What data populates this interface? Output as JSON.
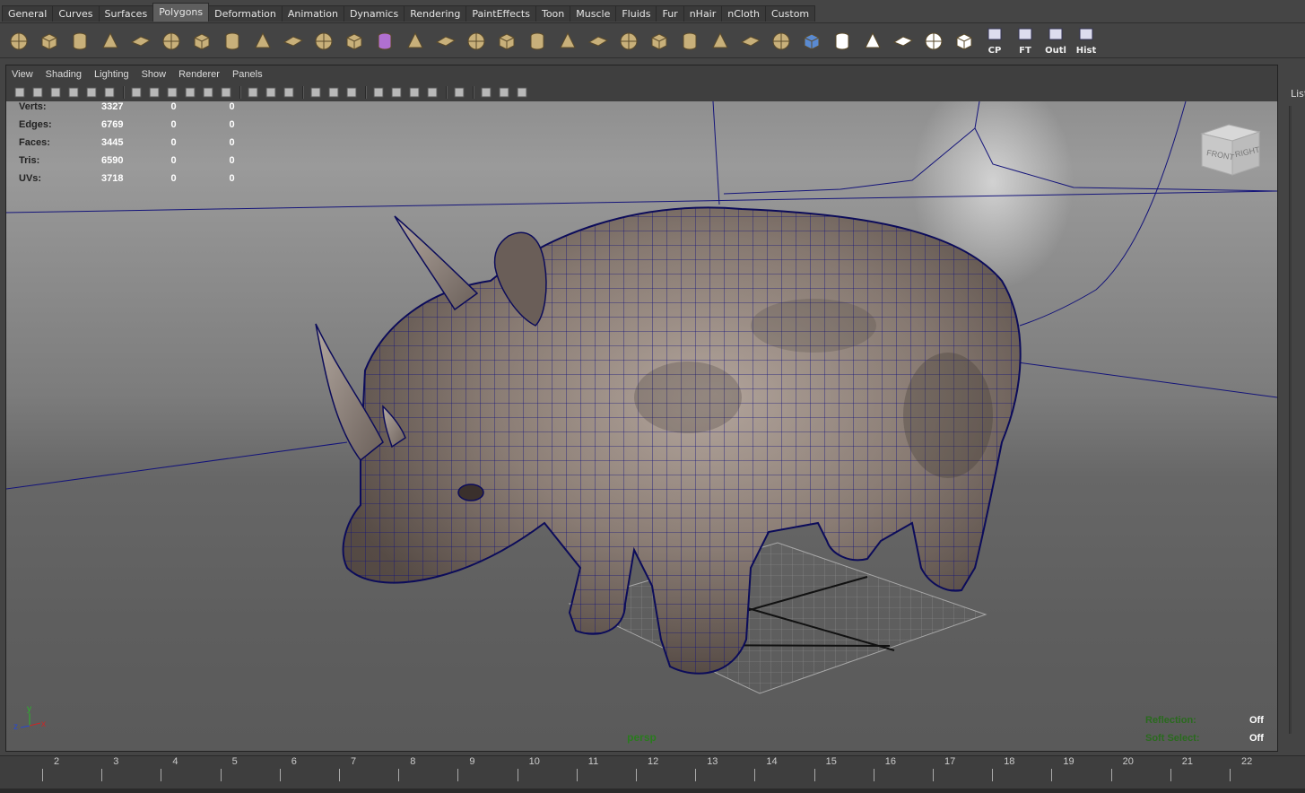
{
  "shelf_tabs": [
    "General",
    "Curves",
    "Surfaces",
    "Polygons",
    "Deformation",
    "Animation",
    "Dynamics",
    "Rendering",
    "PaintEffects",
    "Toon",
    "Muscle",
    "Fluids",
    "Fur",
    "nHair",
    "nCloth",
    "Custom"
  ],
  "active_shelf_tab": "Polygons",
  "shelf_icons": [
    {
      "icon": "poly-sphere-icon",
      "color": "#c8b07a"
    },
    {
      "icon": "poly-cube-icon",
      "color": "#c8b07a"
    },
    {
      "icon": "poly-cylinder-icon",
      "color": "#c8b07a"
    },
    {
      "icon": "poly-cone-icon",
      "color": "#c8b07a"
    },
    {
      "icon": "poly-plane-icon",
      "color": "#c8b07a"
    },
    {
      "icon": "poly-torus-icon",
      "color": "#c8b07a"
    },
    {
      "icon": "poly-pyramid-icon",
      "color": "#c8b07a"
    },
    {
      "icon": "poly-pipe-icon",
      "color": "#c8b07a"
    },
    {
      "icon": "poly-soccerball-icon",
      "color": "#c8b07a"
    },
    {
      "icon": "combine-icon",
      "color": "#c8b07a"
    },
    {
      "icon": "separate-icon",
      "color": "#c8b07a"
    },
    {
      "icon": "extract-icon",
      "color": "#c8b07a"
    },
    {
      "icon": "smooth-icon",
      "color": "#b070d0"
    },
    {
      "icon": "bevel-icon",
      "color": "#c8b07a"
    },
    {
      "icon": "bridge-icon",
      "color": "#c8b07a"
    },
    {
      "icon": "append-icon",
      "color": "#c8b07a"
    },
    {
      "icon": "extrude-icon",
      "color": "#c8b07a"
    },
    {
      "icon": "split-icon",
      "color": "#c8b07a"
    },
    {
      "icon": "insert-loop-icon",
      "color": "#c8b07a"
    },
    {
      "icon": "offset-loop-icon",
      "color": "#c8b07a"
    },
    {
      "icon": "duplicate-face-icon",
      "color": "#c8b07a"
    },
    {
      "icon": "merge-icon",
      "color": "#c8b07a"
    },
    {
      "icon": "collapse-icon",
      "color": "#c8b07a"
    },
    {
      "icon": "fill-hole-icon",
      "color": "#c8b07a"
    },
    {
      "icon": "planar-map-icon",
      "color": "#c8b07a"
    },
    {
      "icon": "cylindrical-map-icon",
      "color": "#c8b07a"
    },
    {
      "icon": "spherical-map-icon",
      "color": "#5a8ad0"
    },
    {
      "icon": "automatic-map-icon",
      "color": "#ffffff"
    },
    {
      "icon": "uv-layout-icon",
      "color": "#ffffff"
    },
    {
      "icon": "checker-icon",
      "color": "#ffffff"
    },
    {
      "icon": "uv-snapshot-icon",
      "color": "#ffffff"
    },
    {
      "icon": "uv-editor-icon",
      "color": "#ffffff"
    }
  ],
  "shelf_text_buttons": [
    {
      "icon": "center-pivot-icon",
      "label": "CP"
    },
    {
      "icon": "freeze-transform-icon",
      "label": "FT"
    },
    {
      "icon": "outliner-icon",
      "label": "Outl"
    },
    {
      "icon": "history-icon",
      "label": "Hist"
    }
  ],
  "panel_menu": [
    "View",
    "Shading",
    "Lighting",
    "Show",
    "Renderer",
    "Panels"
  ],
  "hud_stats": [
    {
      "label": "Verts:",
      "values": [
        "3327",
        "0",
        "0"
      ]
    },
    {
      "label": "Edges:",
      "values": [
        "6769",
        "0",
        "0"
      ]
    },
    {
      "label": "Faces:",
      "values": [
        "3445",
        "0",
        "0"
      ]
    },
    {
      "label": "Tris:",
      "values": [
        "6590",
        "0",
        "0"
      ]
    },
    {
      "label": "UVs:",
      "values": [
        "3718",
        "0",
        "0"
      ]
    }
  ],
  "viewcube": {
    "front": "FRONT",
    "right": "RIGHT"
  },
  "camera_name": "persp",
  "reflection": {
    "label": "Reflection:",
    "value": "Off"
  },
  "soft_select": {
    "label": "Soft Select:",
    "value": "Off"
  },
  "axis_labels": {
    "x": "x",
    "y": "y",
    "z": "z"
  },
  "timeline_ticks": [
    "2",
    "3",
    "4",
    "5",
    "6",
    "7",
    "8",
    "9",
    "10",
    "11",
    "12",
    "13",
    "14",
    "15",
    "16",
    "17",
    "18",
    "19",
    "20",
    "21",
    "22"
  ],
  "right_panel_label": "List",
  "wireframe_color": "#14147a"
}
